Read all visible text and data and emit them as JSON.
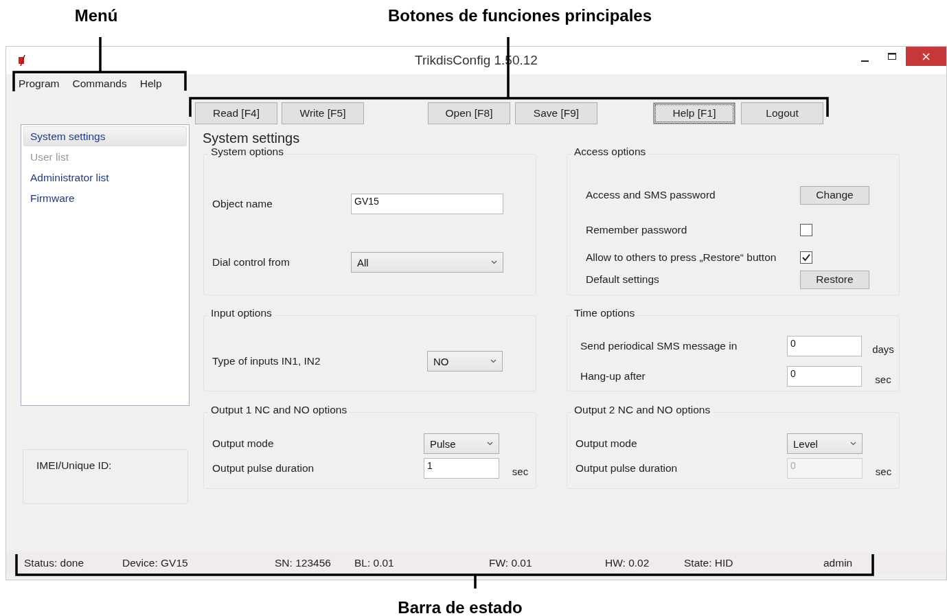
{
  "annotations": [
    {
      "text": "Menú"
    },
    {
      "text": "Botones de funciones principales"
    },
    {
      "text": "Barra de estado"
    }
  ],
  "window": {
    "title": "TrikdisConfig 1.50.12"
  },
  "menu": [
    "Program",
    "Commands",
    "Help"
  ],
  "toolbar": [
    {
      "label": "Read [F4]",
      "focused": false
    },
    {
      "label": "Write [F5]",
      "focused": false
    },
    {
      "label": "Open [F8]",
      "focused": false
    },
    {
      "label": "Save [F9]",
      "focused": false
    },
    {
      "label": "Help [F1]",
      "focused": true
    },
    {
      "label": "Logout",
      "focused": false
    }
  ],
  "sidebar": {
    "items": [
      {
        "label": "System settings",
        "selected": true,
        "disabled": false
      },
      {
        "label": "User list",
        "selected": false,
        "disabled": true
      },
      {
        "label": "Administrator list",
        "selected": false,
        "disabled": false
      },
      {
        "label": "Firmware",
        "selected": false,
        "disabled": false
      }
    ],
    "imei_label": "IMEI/Unique ID:"
  },
  "heading": "System settings",
  "groups": [
    {
      "title": "System options",
      "rows": [
        {
          "kind": "input",
          "label": "Object name",
          "value": "GV15",
          "disabled": false
        },
        {
          "kind": "select",
          "label": "Dial control from",
          "value": "All"
        }
      ]
    },
    {
      "title": "Access options",
      "rows": [
        {
          "kind": "button",
          "label": "Access and SMS password",
          "value": "Change"
        },
        {
          "kind": "checkbox",
          "label": "Remember password",
          "checked": false
        },
        {
          "kind": "checkbox",
          "label": "Allow to others to press „Restore“ button",
          "checked": true
        },
        {
          "kind": "button",
          "label": "Default settings",
          "value": "Restore"
        }
      ]
    },
    {
      "title": "Input options",
      "rows": [
        {
          "kind": "select",
          "label": "Type of inputs IN1, IN2",
          "value": "NO"
        }
      ]
    },
    {
      "title": "Time options",
      "rows": [
        {
          "kind": "input",
          "label": "Send periodical SMS message in",
          "value": "0",
          "unit": "days",
          "disabled": false
        },
        {
          "kind": "input",
          "label": "Hang-up after",
          "value": "0",
          "unit": "sec",
          "disabled": false
        }
      ]
    },
    {
      "title": "Output 1 NC and NO options",
      "rows": [
        {
          "kind": "select",
          "label": "Output mode",
          "value": "Pulse"
        },
        {
          "kind": "input",
          "label": "Output pulse duration",
          "value": "1",
          "unit": "sec",
          "disabled": false
        }
      ]
    },
    {
      "title": "Output 2 NC and NO options",
      "rows": [
        {
          "kind": "select",
          "label": "Output mode",
          "value": "Level"
        },
        {
          "kind": "input",
          "label": "Output pulse duration",
          "value": "0",
          "unit": "sec",
          "disabled": true
        }
      ]
    }
  ],
  "status_bar": [
    "Status: done",
    "Device: GV15",
    "SN: 123456",
    "BL: 0.01",
    "FW: 0.01",
    "HW: 0.02",
    "State: HID",
    "admin"
  ]
}
